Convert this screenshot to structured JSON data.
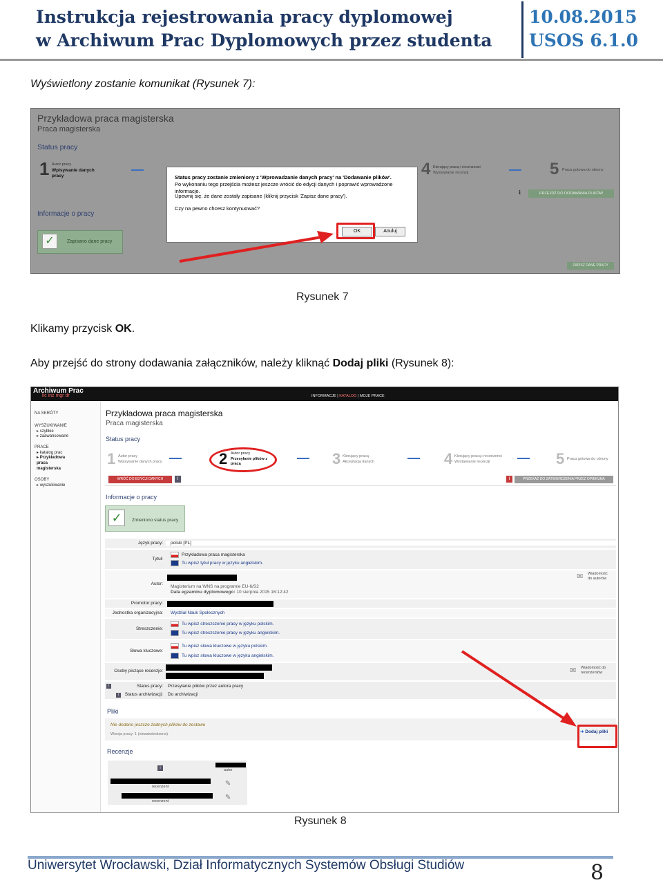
{
  "header": {
    "title_line1": "Instrukcja rejestrowania pracy dyplomowej",
    "title_line2": "w Archiwum Prac Dyplomowych przez studenta",
    "date": "10.08.2015",
    "version": "USOS 6.1.0"
  },
  "body": {
    "intro": "Wyświetlony zostanie komunikat (Rysunek 7):",
    "caption7": "Rysunek 7",
    "click_text_prefix": "Klikamy przycisk ",
    "click_text_bold": "OK",
    "click_text_suffix": ".",
    "goto_prefix": "Aby przejść do strony dodawania załączników, należy kliknąć ",
    "goto_bold": "Dodaj pliki",
    "goto_suffix": " (Rysunek 8):",
    "caption8": "Rysunek 8"
  },
  "shot1": {
    "title": "Przykładowa praca magisterska",
    "subtitle": "Praca magisterska",
    "status_heading": "Status pracy",
    "step1_num": "1",
    "step1_who": "Autor pracy",
    "step1_label": "Wpisywanie danych pracy",
    "step4_num": "4",
    "step4_who": "Kierujący pracą i recenzenci",
    "step4_label": "Wystawianie recenzji",
    "step5_num": "5",
    "step5_label": "Praca gotowa do obrony",
    "next_button": "PRZEJDŹ DO DODAWANIA PLIKÓW",
    "info_heading": "Informacje o pracy",
    "saved_label": "Zapisano dane pracy",
    "save_button": "ZAPISZ DANE PRACY",
    "dialog": {
      "line1": "Status pracy zostanie zmieniony z 'Wprowadzanie danych pracy' na 'Dodawanie plików'.",
      "line2": "Po wykonaniu tego przejścia możesz jeszcze wrócić do edycji danych i poprawić wprowadzone informacje.",
      "line3": "Upewnij się, że dane zostały zapisane (kliknij przycisk 'Zapisz dane pracy').",
      "line4": "Czy na pewno chcesz kontynuować?",
      "ok": "OK",
      "cancel": "Anuluj"
    }
  },
  "shot2": {
    "app_title": "Archiwum Prac",
    "app_sub": "lic inż mgr dr",
    "topnav": [
      "INFORMACJE",
      "KATALOG",
      "MOJE",
      "PRACE"
    ],
    "sidebar": {
      "shortcuts": "NA SKRÓTY",
      "search": "WYSZUKIWANIE",
      "search_items": [
        "szybkie",
        "zaawansowane"
      ],
      "works": "PRACE",
      "works_items": [
        "katalog prac",
        "Przykładowa praca magisterska"
      ],
      "people": "OSOBY",
      "people_items": [
        "wyszukiwanie"
      ]
    },
    "title": "Przykładowa praca magisterska",
    "subtitle": "Praca magisterska",
    "status_heading": "Status pracy",
    "steps": [
      {
        "num": "1",
        "who": "Autor pracy",
        "label": "Wpisywanie danych pracy"
      },
      {
        "num": "2",
        "who": "Autor pracy",
        "label": "Przesyłanie plików z pracą"
      },
      {
        "num": "3",
        "who": "Kierujący pracą",
        "label": "Akceptacja danych"
      },
      {
        "num": "4",
        "who": "Kierujący pracą i recenzenci",
        "label": "Wystawianie recenzji"
      },
      {
        "num": "5",
        "who": "",
        "label": "Praca gotowa do obrony"
      }
    ],
    "back_button": "WRÓĆ DO EDYCJI DANYCH",
    "next_button": "PRZEKAŻ DO ZATWIERDZENIA PRZEZ OPIEKUNA",
    "info_heading": "Informacje o pracy",
    "changed_label": "Zmieniono status pracy",
    "rows": {
      "lang_label": "Język pracy:",
      "lang_value": "polski [PL]",
      "title_label": "Tytuł:",
      "title_pl": "Przykładowa praca magisterska",
      "title_en": "Tu wpisz tytuł pracy w języku angielskim.",
      "author_label": "Autor:",
      "author_program": "Magisterium na WNS na programie EU-6/S2",
      "author_date_label": "Data egzaminu dyplomowego:",
      "author_date": "10 sierpnia 2015 16:12:42",
      "author_msg": "Wiadomość do autorów",
      "promoter_label": "Promotor pracy:",
      "unit_label": "Jednostka organizacyjna:",
      "unit_value": "Wydział Nauk Społecznych",
      "abstract_label": "Streszczenie:",
      "abstract_pl": "Tu wpisz streszczenie pracy w języku polskim.",
      "abstract_en": "Tu wpisz streszczenie pracy w języku angielskim.",
      "keywords_label": "Słowa kluczowe:",
      "keywords_pl": "Tu wpisz słowa kluczowe w języku polskim.",
      "keywords_en": "Tu wpisz słowa kluczowe w języku angielskim.",
      "reviewers_label": "Osoby piszące recenzje:",
      "reviewers_msg": "Wiadomość do recenzentów",
      "status_label": "Status pracy:",
      "status_value": "Przesyłanie plików przez autora pracy",
      "archive_label": "Status archiwizacji:",
      "archive_value": "Do archiwizacji"
    },
    "files_heading": "Pliki",
    "files_none": "Nie dodano jeszcze żadnych plików do zestawu",
    "files_version": "Wersja pracy: 1 (niezatwierdzona)",
    "add_files": "Dodaj pliki",
    "reviews_heading": "Recenzje",
    "review_roles": [
      "autor",
      "recenzent",
      "recenzent"
    ]
  },
  "footer": {
    "text": "Uniwersytet Wrocławski, Dział Informatycznych Systemów Obsługi Studiów",
    "page": "8"
  },
  "colors": {
    "header_navy": "#1f3864",
    "header_blue": "#2e74b5",
    "annotation_red": "#e02020",
    "link_blue": "#1a3a8a"
  }
}
